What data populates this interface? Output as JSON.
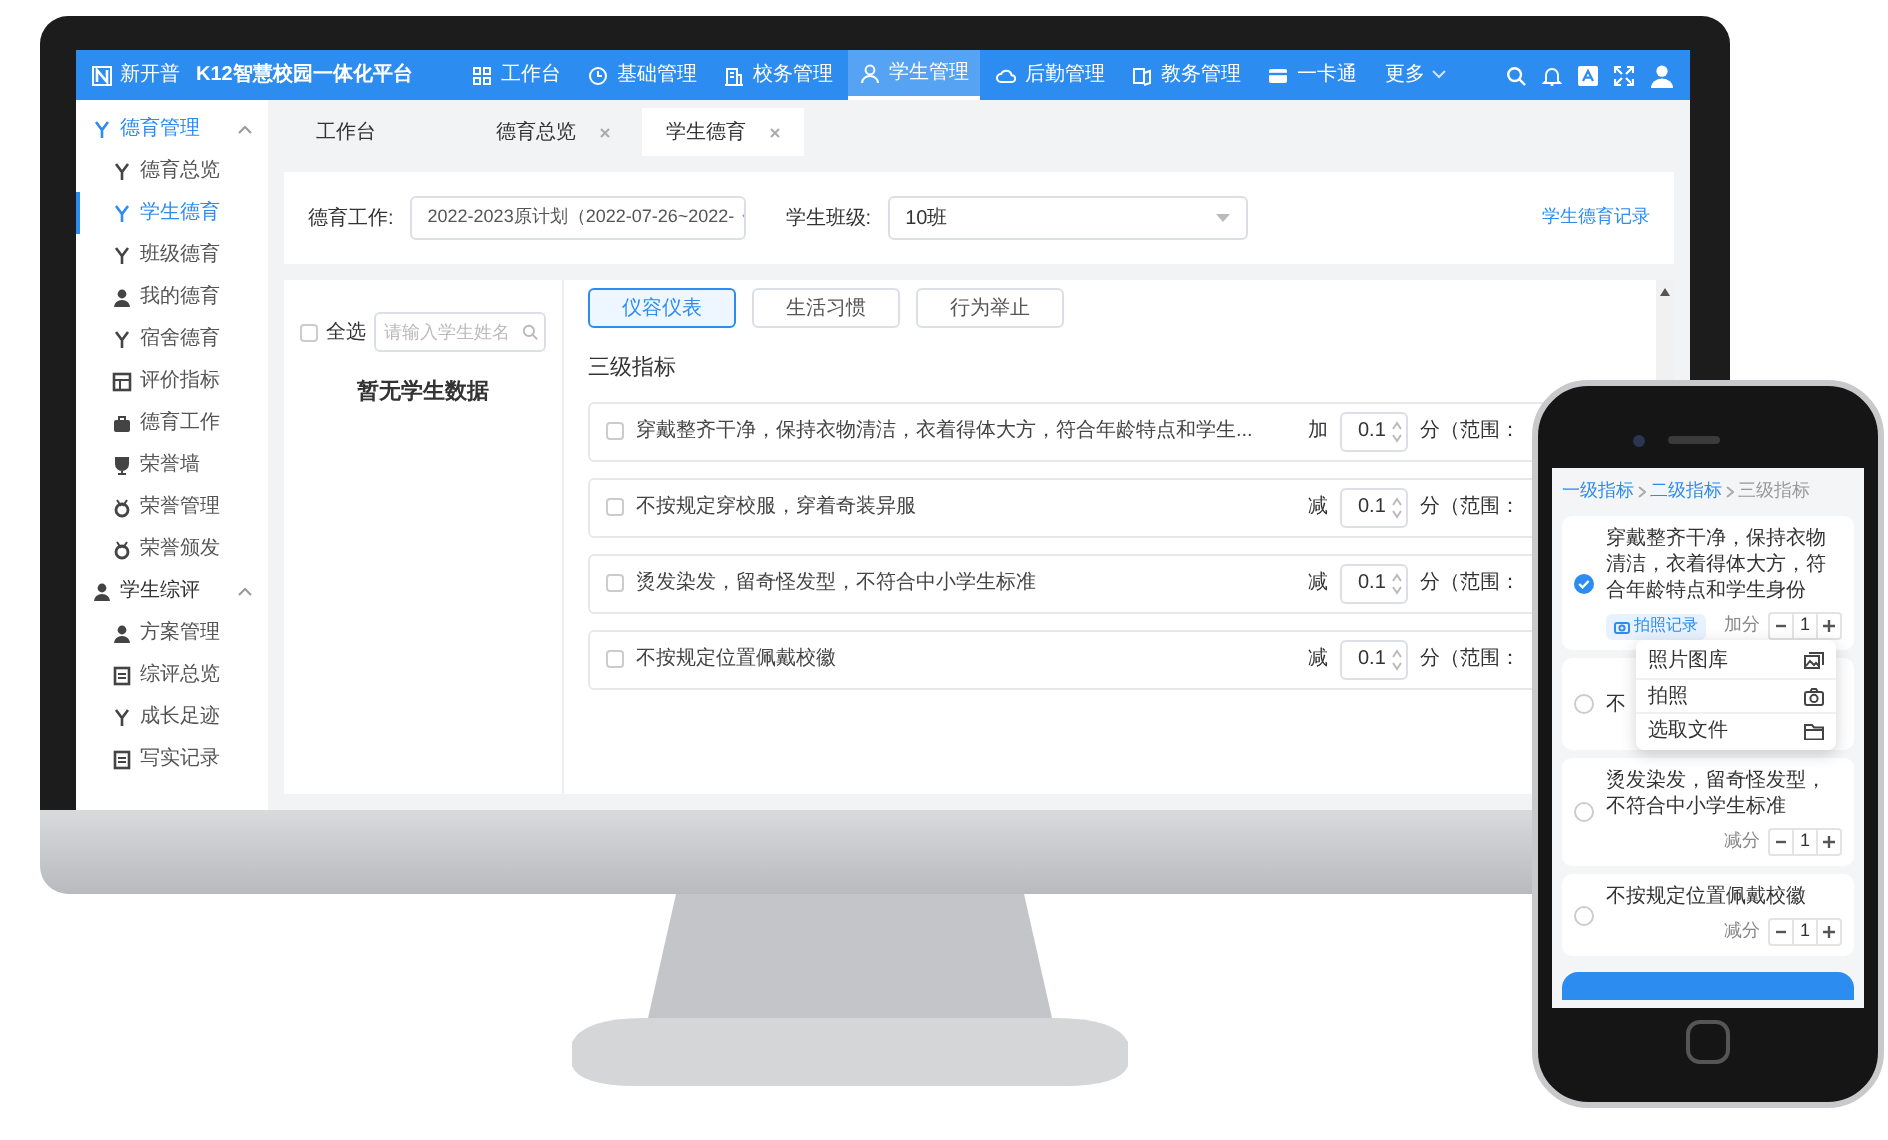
{
  "nav": {
    "brand": "新开普",
    "title": "K12智慧校园一体化平台",
    "items": [
      {
        "label": "工作台",
        "selected": false
      },
      {
        "label": "基础管理",
        "selected": false
      },
      {
        "label": "校务管理",
        "selected": false
      },
      {
        "label": "学生管理",
        "selected": true
      },
      {
        "label": "后勤管理",
        "selected": false
      },
      {
        "label": "教务管理",
        "selected": false
      },
      {
        "label": "一卡通",
        "selected": false
      }
    ],
    "more": "更多"
  },
  "sidebar": {
    "groups": [
      {
        "label": "德育管理",
        "expanded": true,
        "selected": true,
        "children": [
          {
            "label": "德育总览",
            "selected": false
          },
          {
            "label": "学生德育",
            "selected": true
          },
          {
            "label": "班级德育",
            "selected": false
          },
          {
            "label": "我的德育",
            "selected": false
          },
          {
            "label": "宿舍德育",
            "selected": false
          },
          {
            "label": "评价指标",
            "selected": false
          },
          {
            "label": "德育工作",
            "selected": false
          },
          {
            "label": "荣誉墙",
            "selected": false
          },
          {
            "label": "荣誉管理",
            "selected": false
          },
          {
            "label": "荣誉颁发",
            "selected": false
          }
        ]
      },
      {
        "label": "学生综评",
        "expanded": true,
        "selected": false,
        "children": [
          {
            "label": "方案管理",
            "selected": false
          },
          {
            "label": "综评总览",
            "selected": false
          },
          {
            "label": "成长足迹",
            "selected": false
          },
          {
            "label": "写实记录",
            "selected": false
          }
        ]
      }
    ]
  },
  "tabs": [
    {
      "label": "工作台",
      "selected": false,
      "closable": false
    },
    {
      "label": "德育总览",
      "selected": false,
      "closable": true
    },
    {
      "label": "学生德育",
      "selected": true,
      "closable": true
    }
  ],
  "filters": {
    "work_label": "德育工作:",
    "work_value": "2022-2023原计划（2022-07-26~2022-",
    "class_label": "学生班级:",
    "class_value": "10班",
    "record_link": "学生德育记录"
  },
  "student_panel": {
    "select_all": "全选",
    "select_all_checked": false,
    "search_placeholder": "请输入学生姓名",
    "empty": "暂无学生数据"
  },
  "categories": [
    {
      "label": "仪容仪表",
      "selected": true
    },
    {
      "label": "生活习惯",
      "selected": false
    },
    {
      "label": "行为举止",
      "selected": false
    }
  ],
  "level_title": "三级指标",
  "indicators": [
    {
      "text": "穿戴整齐干净，保持衣物清洁，衣着得体大方，符合年龄特点和学生...",
      "checked": false,
      "sign": "加",
      "value": "0.1",
      "unit": "分（范围："
    },
    {
      "text": "不按规定穿校服，穿着奇装异服",
      "checked": false,
      "sign": "减",
      "value": "0.1",
      "unit": "分（范围："
    },
    {
      "text": "烫发染发，留奇怪发型，不符合中小学生标准",
      "checked": false,
      "sign": "减",
      "value": "0.1",
      "unit": "分（范围："
    },
    {
      "text": "不按规定位置佩戴校徽",
      "checked": false,
      "sign": "减",
      "value": "0.1",
      "unit": "分（范围："
    }
  ],
  "phone": {
    "breadcrumb": [
      {
        "label": "一级指标",
        "current": false
      },
      {
        "label": "二级指标",
        "current": false
      },
      {
        "label": "三级指标",
        "current": true
      }
    ],
    "items": [
      {
        "text": "穿戴整齐干净，保持衣物清洁，衣着得体大方，符合年龄特点和学生身份",
        "selected": true,
        "record_button": "拍照记录",
        "score_label": "加分",
        "value": "1"
      },
      {
        "text": "不",
        "selected": false
      },
      {
        "text": "烫发染发，留奇怪发型，不符合中小学生标准",
        "selected": false,
        "score_label": "减分",
        "value": "1"
      },
      {
        "text": "不按规定位置佩戴校徽",
        "selected": false,
        "score_label": "减分",
        "value": "1"
      }
    ],
    "menu": [
      {
        "label": "照片图库",
        "kind": "gallery"
      },
      {
        "label": "拍照",
        "kind": "camera"
      },
      {
        "label": "选取文件",
        "kind": "folder"
      }
    ]
  }
}
